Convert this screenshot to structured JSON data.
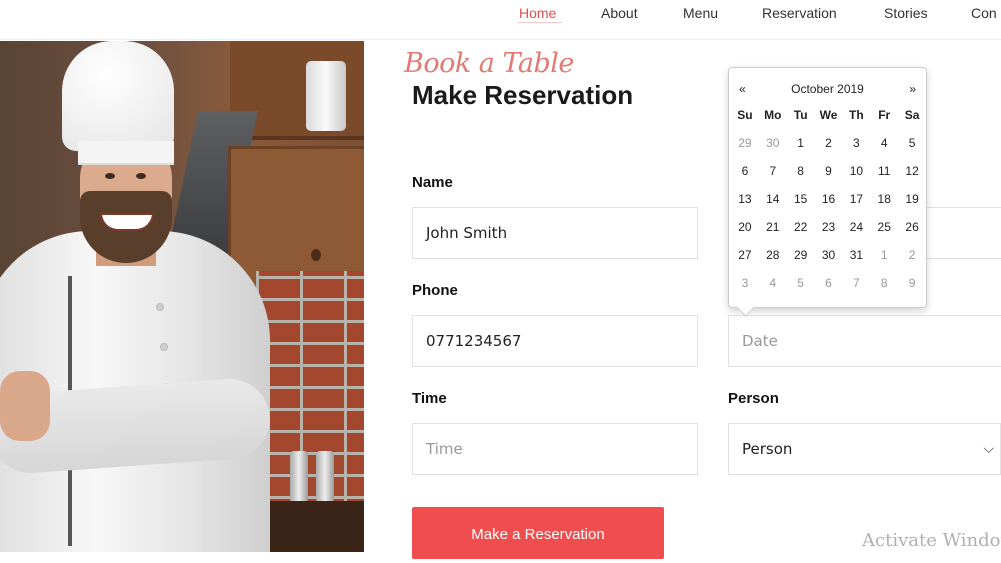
{
  "nav": {
    "items": [
      {
        "label": "Home",
        "active": true
      },
      {
        "label": "About",
        "active": false
      },
      {
        "label": "Menu",
        "active": false
      },
      {
        "label": "Reservation",
        "active": false
      },
      {
        "label": "Stories",
        "active": false
      },
      {
        "label": "Con",
        "active": false
      }
    ],
    "accent": "#e04f4f"
  },
  "form": {
    "script_heading": "Book a Table",
    "title": "Make Reservation",
    "name_label": "Name",
    "name_value": "John Smith",
    "phone_label": "Phone",
    "phone_value": "0771234567",
    "date_placeholder": "Date",
    "time_label": "Time",
    "time_placeholder": "Time",
    "person_label": "Person",
    "person_selected": "Person",
    "submit_label": "Make a Reservation",
    "button_color": "#f04e4e"
  },
  "datepicker": {
    "prev": "«",
    "next": "»",
    "month": "October 2019",
    "weekdays": [
      "Su",
      "Mo",
      "Tu",
      "We",
      "Th",
      "Fr",
      "Sa"
    ],
    "weeks": [
      [
        {
          "d": "29",
          "old": true
        },
        {
          "d": "30",
          "old": true
        },
        {
          "d": "1"
        },
        {
          "d": "2"
        },
        {
          "d": "3"
        },
        {
          "d": "4"
        },
        {
          "d": "5"
        }
      ],
      [
        {
          "d": "6"
        },
        {
          "d": "7"
        },
        {
          "d": "8"
        },
        {
          "d": "9"
        },
        {
          "d": "10"
        },
        {
          "d": "11"
        },
        {
          "d": "12"
        }
      ],
      [
        {
          "d": "13"
        },
        {
          "d": "14"
        },
        {
          "d": "15"
        },
        {
          "d": "16"
        },
        {
          "d": "17"
        },
        {
          "d": "18"
        },
        {
          "d": "19"
        }
      ],
      [
        {
          "d": "20"
        },
        {
          "d": "21"
        },
        {
          "d": "22"
        },
        {
          "d": "23"
        },
        {
          "d": "24"
        },
        {
          "d": "25"
        },
        {
          "d": "26"
        }
      ],
      [
        {
          "d": "27"
        },
        {
          "d": "28"
        },
        {
          "d": "29"
        },
        {
          "d": "30"
        },
        {
          "d": "31"
        },
        {
          "d": "1",
          "old": true
        },
        {
          "d": "2",
          "old": true
        }
      ],
      [
        {
          "d": "3",
          "old": true
        },
        {
          "d": "4",
          "old": true
        },
        {
          "d": "5",
          "old": true
        },
        {
          "d": "6",
          "old": true
        },
        {
          "d": "7",
          "old": true
        },
        {
          "d": "8",
          "old": true
        },
        {
          "d": "9",
          "old": true
        }
      ]
    ]
  },
  "overlay": {
    "watermark": "Activate Windows"
  }
}
